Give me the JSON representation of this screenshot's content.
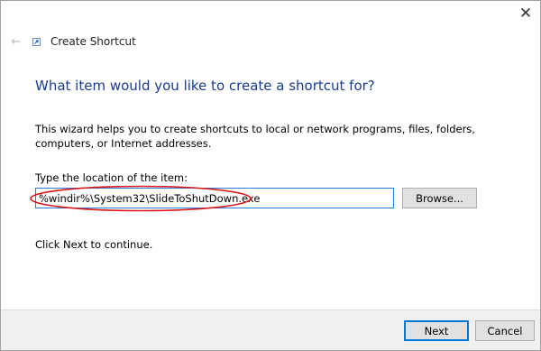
{
  "window": {
    "title": "Create Shortcut",
    "close_glyph": "✕",
    "back_glyph": "←"
  },
  "icons": {
    "back": "back-arrow-icon",
    "wizard": "shortcut-wizard-icon",
    "close": "close-icon"
  },
  "wizard": {
    "heading": "What item would you like to create a shortcut for?",
    "description": "This wizard helps you to create shortcuts to local or network programs, files, folders, computers, or Internet addresses.",
    "location_label": "Type the location of the item:",
    "location_value": "%windir%\\System32\\SlideToShutDown.exe",
    "browse_label": "Browse...",
    "continue_text": "Click Next to continue."
  },
  "footer": {
    "next_label": "Next",
    "cancel_label": "Cancel"
  },
  "colors": {
    "heading": "#1a3c8f",
    "highlight": "#d9191c",
    "input_border": "#2c7bd6",
    "default_button_border": "#0078d7"
  }
}
